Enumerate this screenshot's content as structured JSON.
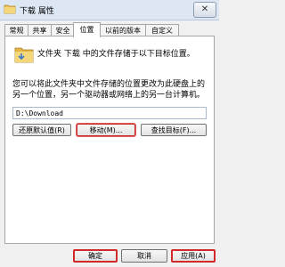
{
  "window": {
    "title": "下载 属性",
    "close_glyph": "✕"
  },
  "tabs": [
    {
      "label": "常规"
    },
    {
      "label": "共享"
    },
    {
      "label": "安全"
    },
    {
      "label": "位置"
    },
    {
      "label": "以前的版本"
    },
    {
      "label": "自定义"
    }
  ],
  "active_tab": "位置",
  "location": {
    "heading": "文件夹 下载 中的文件存储于以下目标位置。",
    "description": "您可以将此文件夹中文件存储的位置更改为此硬盘上的另一个位置，另一个驱动器或网络上的另一台计算机。",
    "path_value": "D:\\Download"
  },
  "buttons": {
    "restore_default": "还原默认值(R)",
    "move": "移动(M)...",
    "find_target": "查找目标(F)..."
  },
  "footer": {
    "ok": "确定",
    "cancel": "取消",
    "apply": "应用(A)"
  }
}
